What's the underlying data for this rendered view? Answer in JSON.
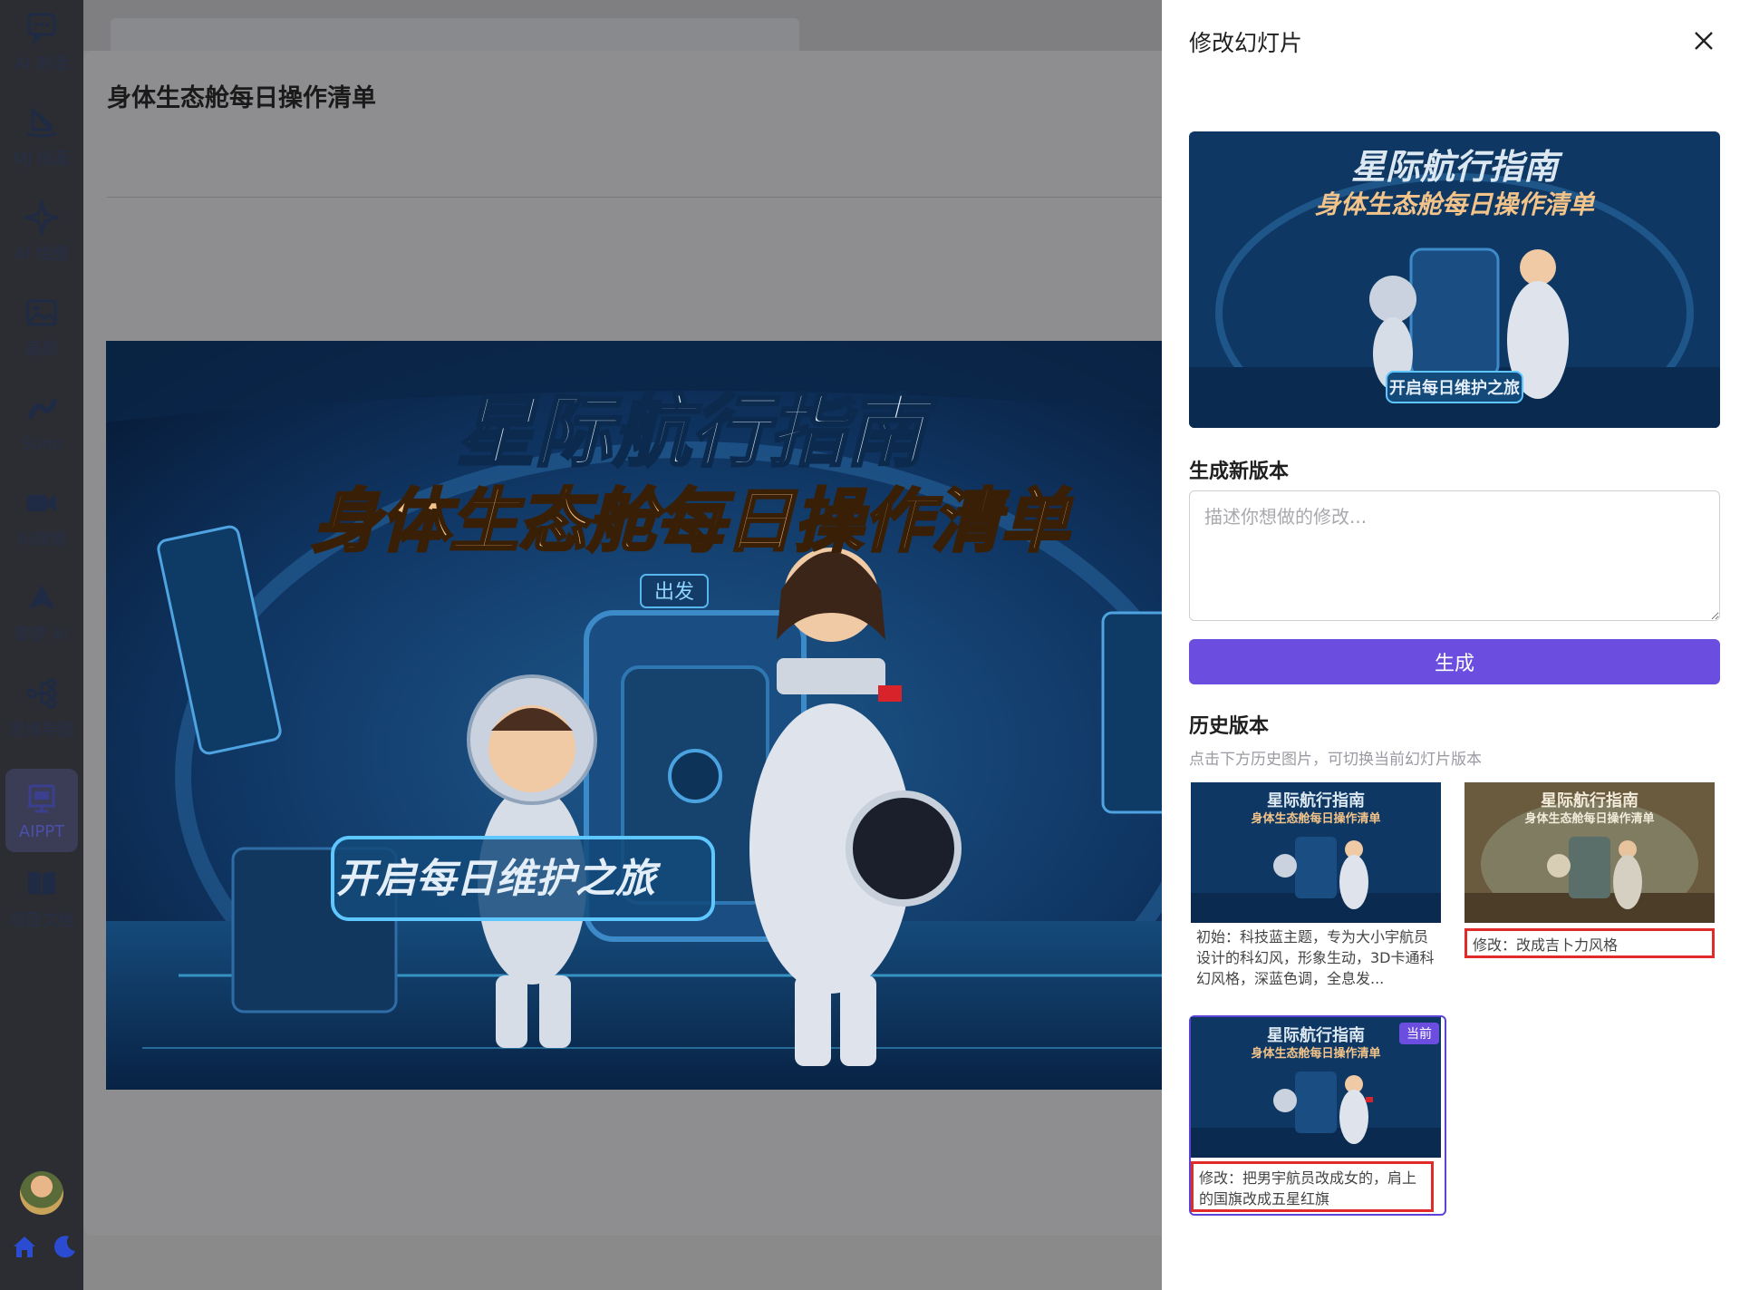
{
  "sidebar": {
    "items": [
      {
        "label": "AI 对话",
        "icon": "chat-bubble-icon"
      },
      {
        "label": "MJ 绘画",
        "icon": "sailboat-icon"
      },
      {
        "label": "AI 绘图",
        "icon": "sparkle-icon"
      },
      {
        "label": "画廊",
        "icon": "image-icon"
      },
      {
        "label": "Suno",
        "icon": "music-icon"
      },
      {
        "label": "AI视频",
        "icon": "video-camera-icon"
      },
      {
        "label": "即梦 AI",
        "icon": "dream-icon"
      },
      {
        "label": "思维导图",
        "icon": "mind-map-icon"
      },
      {
        "label": "AIPPT",
        "icon": "presentation-icon",
        "active": true
      },
      {
        "label": "项目文档",
        "icon": "book-icon"
      }
    ],
    "bottom_icons": [
      "home-icon",
      "moon-icon"
    ]
  },
  "modal": {
    "title": "身体生态舱每日操作清单"
  },
  "slide": {
    "title_line1": "星际航行指南",
    "title_line2": "身体生态舱每日操作清单",
    "door_sign": "出发",
    "banner": "开启每日维护之旅"
  },
  "panel": {
    "title": "修改幻灯片",
    "new_version_label": "生成新版本",
    "textarea_placeholder": "描述你想做的修改...",
    "generate_button": "生成",
    "history_label": "历史版本",
    "history_hint": "点击下方历史图片，可切换当前幻灯片版本",
    "current_badge": "当前",
    "history": [
      {
        "desc": "初始：科技蓝主题，专为大小宇航员设计的科幻风，形象生动，3D卡通科幻风格，深蓝色调，全息发..."
      },
      {
        "desc": "修改：改成吉卜力风格"
      },
      {
        "desc": "修改：把男宇航员改成女的，肩上的国旗改成五星红旗"
      }
    ]
  },
  "colors": {
    "accent": "#6b4ee0",
    "highlight": "#e12b2b",
    "slide_text": "#dbe8f2",
    "slide_title2": "#f3c48a"
  }
}
